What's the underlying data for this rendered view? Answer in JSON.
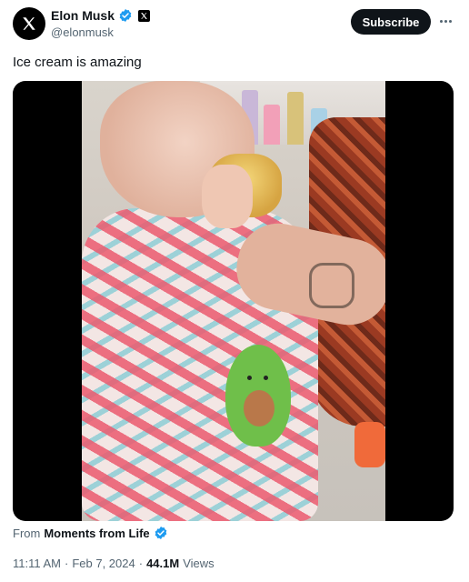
{
  "author": {
    "display_name": "Elon Musk",
    "handle": "@elonmusk"
  },
  "actions": {
    "subscribe_label": "Subscribe"
  },
  "tweet": {
    "text": "Ice cream is amazing"
  },
  "attribution": {
    "prefix": "From",
    "source": "Moments from Life"
  },
  "meta": {
    "time": "11:11 AM",
    "separator1": "·",
    "date": "Feb 7, 2024",
    "separator2": "·",
    "views_count": "44.1M",
    "views_label": "Views"
  },
  "icons": {
    "avatar": "x-logo-icon",
    "verified": "verified-badge-icon",
    "affiliate": "x-affiliate-badge-icon",
    "more": "more-options-icon"
  },
  "colors": {
    "verified_blue": "#1d9bf0",
    "text_primary": "#0f1419",
    "text_secondary": "#536471",
    "button_bg": "#0f1419"
  }
}
